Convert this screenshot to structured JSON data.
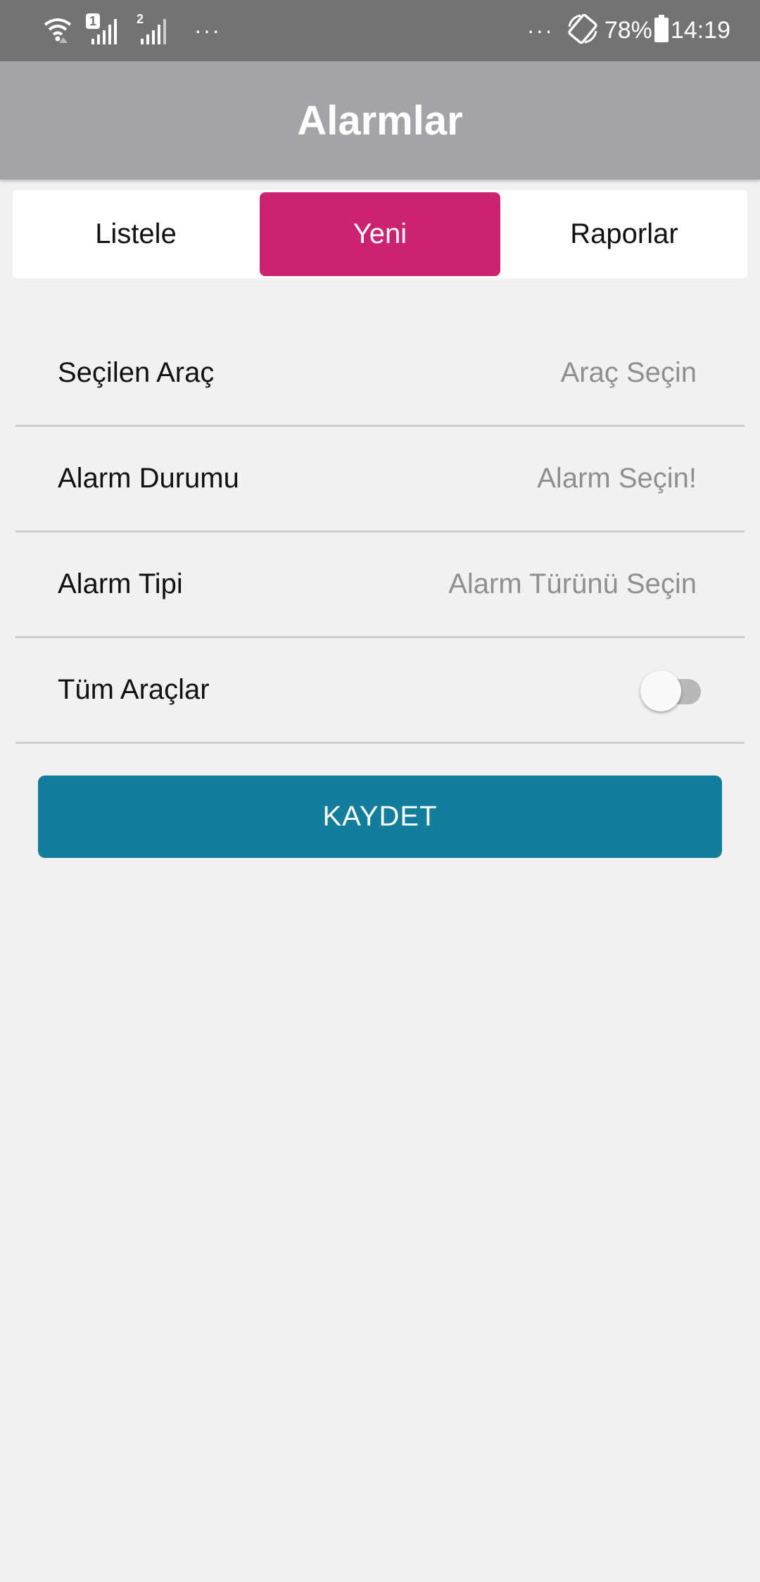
{
  "status_bar": {
    "sim1_label": "1",
    "sim2_label": "2",
    "left_dots": "···",
    "right_dots": "···",
    "battery_percent": "78%",
    "time": "14:19",
    "icons": [
      "wifi-icon",
      "signal-sim1-icon",
      "signal-sim2-icon",
      "rotate-icon",
      "battery-icon"
    ]
  },
  "header": {
    "title": "Alarmlar"
  },
  "tabs": [
    {
      "label": "Listele",
      "active": false
    },
    {
      "label": "Yeni",
      "active": true
    },
    {
      "label": "Raporlar",
      "active": false
    }
  ],
  "form": {
    "vehicle": {
      "label": "Seçilen Araç",
      "value": "Araç Seçin"
    },
    "alarm_status": {
      "label": "Alarm Durumu",
      "value": "Alarm Seçin!"
    },
    "alarm_type": {
      "label": "Alarm Tipi",
      "value": "Alarm Türünü Seçin"
    },
    "all_vehicles": {
      "label": "Tüm Araçlar",
      "enabled": false
    }
  },
  "save_button": {
    "label": "KAYDET"
  },
  "colors": {
    "status_bar": "#737373",
    "header": "#a2a4a8",
    "active_tab": "#cb2272",
    "save_button": "#127e9c",
    "background": "#f1f1f1"
  }
}
